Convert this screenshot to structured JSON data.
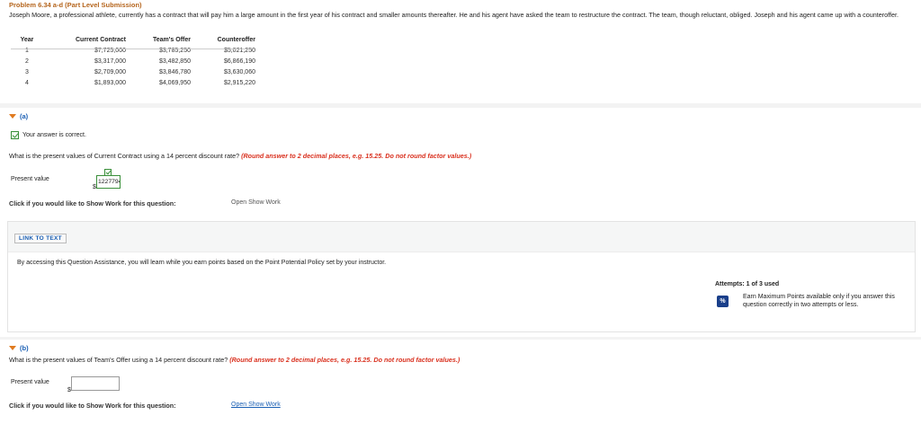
{
  "problem": {
    "title": "Problem 6.34 a-d (Part Level Submission)",
    "text": "Joseph Moore, a professional athlete, currently has a contract that will pay him a large amount in the first year of his contract and smaller amounts thereafter. He and his agent have asked the team to restructure the contract. The team, though reluctant, obliged. Joseph and his agent came up with a counteroffer."
  },
  "table": {
    "headers": [
      "Year",
      "Current Contract",
      "Team's Offer",
      "Counteroffer"
    ],
    "rows": [
      [
        "1",
        "$7,725,000",
        "$3,785,250",
        "$5,021,250"
      ],
      [
        "2",
        "$3,317,000",
        "$3,482,850",
        "$6,866,190"
      ],
      [
        "3",
        "$2,709,000",
        "$3,846,780",
        "$3,630,060"
      ],
      [
        "4",
        "$1,893,000",
        "$4,069,950",
        "$2,915,220"
      ]
    ]
  },
  "part_a": {
    "label": "(a)",
    "status": "Your answer is correct.",
    "question": "What is the present values of Current Contract using a 14 percent discount rate?",
    "hint": "(Round answer to 2 decimal places, e.g. 15.25. Do not round factor values.)",
    "pv_label": "Present value",
    "currency": "$",
    "answer": "12277945.38",
    "show_work_prompt": "Click if you would like to Show Work for this question:",
    "show_work_link": "Open Show Work"
  },
  "assistance": {
    "link_text": "LINK TO TEXT",
    "note": "By accessing this Question Assistance, you will learn while you earn points based on the Point Potential Policy set by your instructor."
  },
  "attempts": {
    "label": "Attempts: 1 of 3 used",
    "icon_text": "%",
    "earn_text": "Earn Maximum Points available only if you answer this question correctly in two attempts or less."
  },
  "part_b": {
    "label": "(b)",
    "question": "What is the present values of Team's Offer using a 14 percent discount rate?",
    "hint": "(Round answer to 2 decimal places, e.g. 15.25. Do not round factor values.)",
    "pv_label": "Present value",
    "currency": "$",
    "answer": "",
    "show_work_prompt": "Click if you would like to Show Work for this question:",
    "show_work_link": "Open Show Work"
  }
}
